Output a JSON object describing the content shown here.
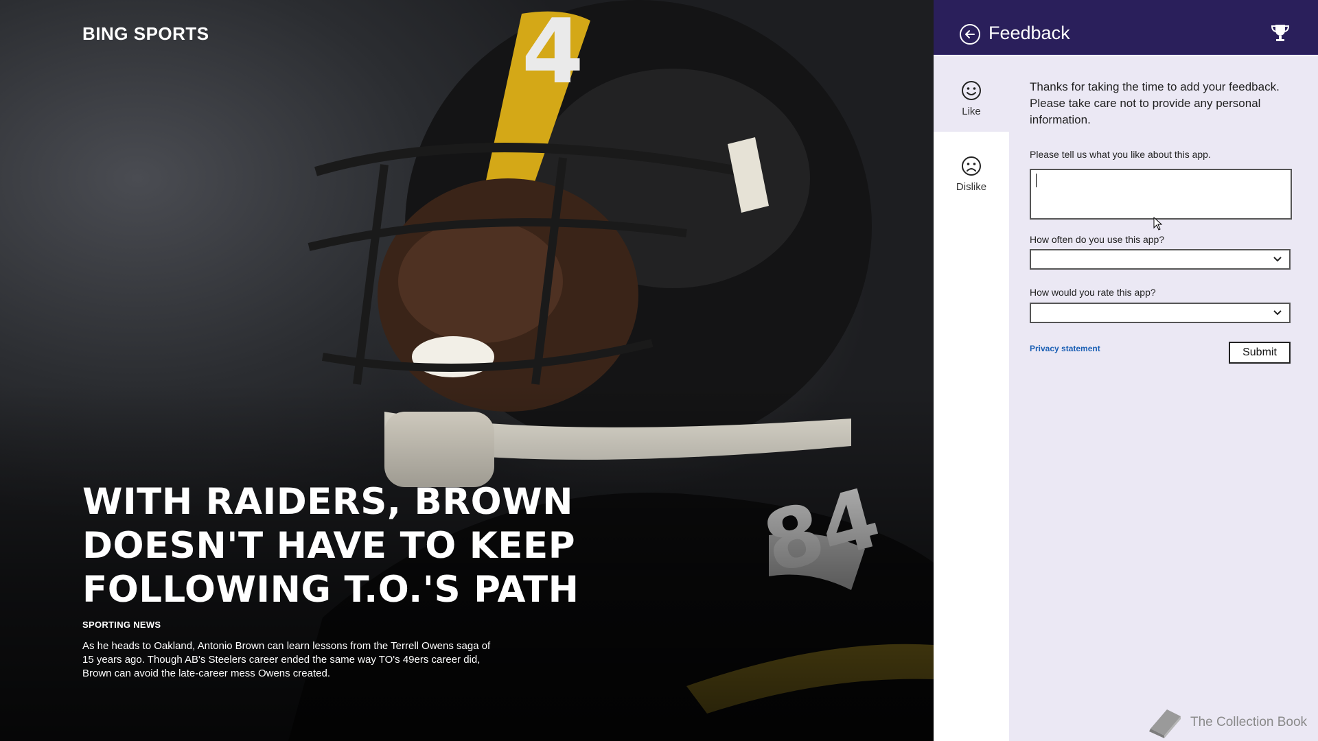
{
  "app": {
    "brand": "BING SPORTS"
  },
  "article": {
    "headline": "WITH RAIDERS, BROWN DOESN'T HAVE TO KEEP FOLLOWING T.O.'S PATH",
    "source": "SPORTING NEWS",
    "summary": "As he heads to Oakland, Antonio Brown can learn lessons from the Terrell Owens saga of 15 years ago. Though AB's Steelers career ended the same way TO's 49ers career did, Brown can avoid the late-career mess Owens created."
  },
  "feedback": {
    "title": "Feedback",
    "header_color": "#2a1f5b",
    "nav": [
      {
        "label": "Like",
        "icon": "smile-icon",
        "selected": true
      },
      {
        "label": "Dislike",
        "icon": "frown-icon",
        "selected": false
      }
    ],
    "intro": "Thanks for taking the time to add your feedback. Please take care not to provide any personal information.",
    "like_label": "Please tell us what you like about this app.",
    "like_value": "",
    "frequency_label": "How often do you use this app?",
    "frequency_value": "",
    "rating_label": "How would you rate this app?",
    "rating_value": "",
    "privacy_link": "Privacy statement",
    "submit_label": "Submit"
  },
  "watermark": {
    "text": "The Collection Book",
    "icon": "book-icon"
  },
  "icons": {
    "back": "back-arrow-circle-icon",
    "trophy": "trophy-icon",
    "dropdown": "chevron-down-icon"
  }
}
